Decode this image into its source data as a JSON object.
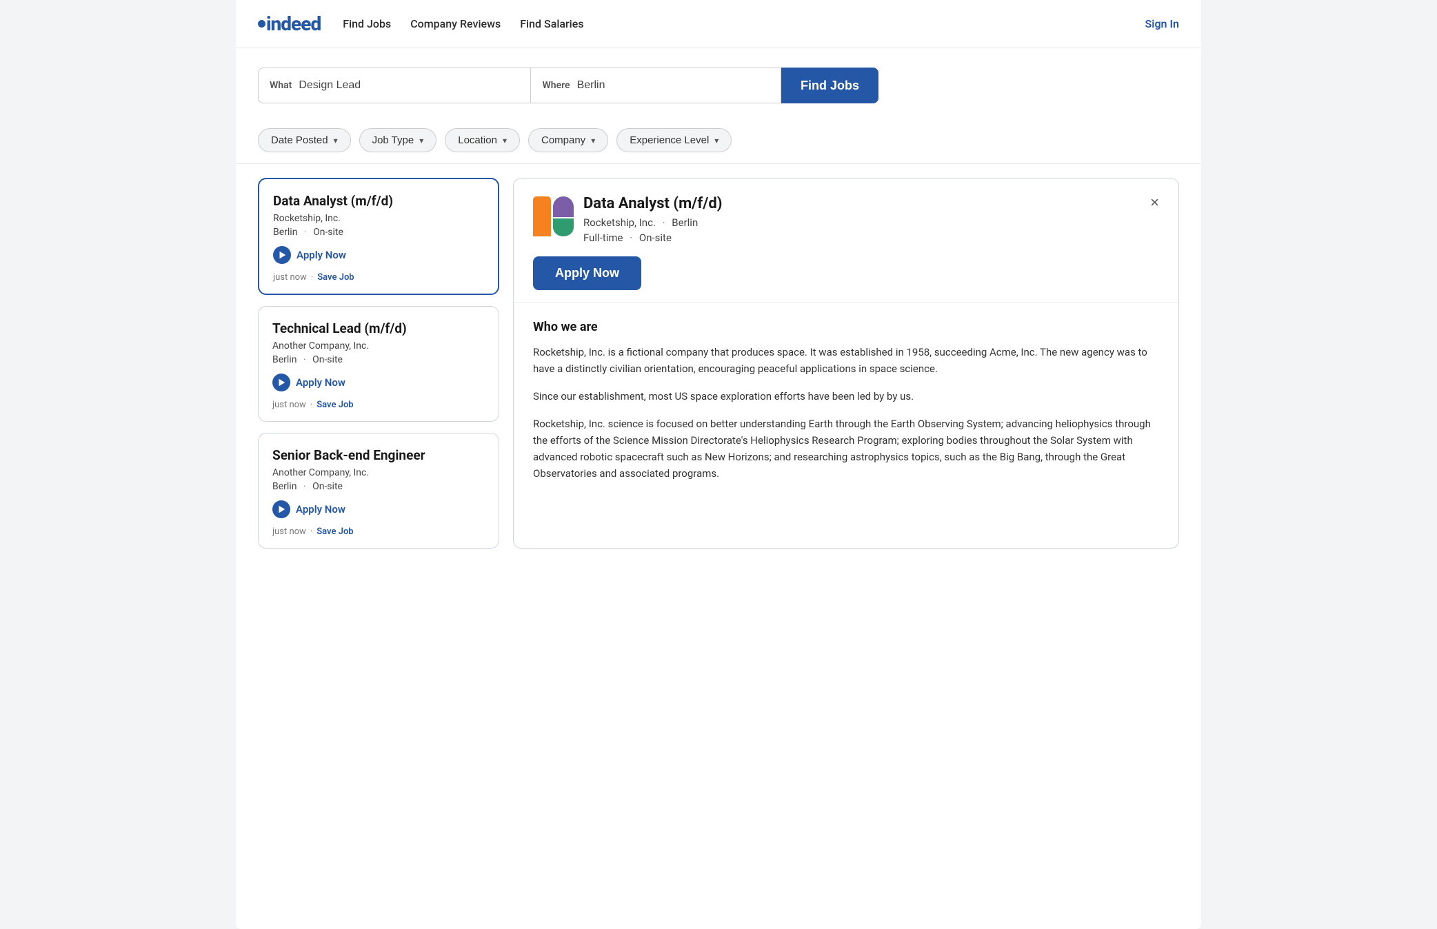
{
  "header": {
    "logo_text": "indeed",
    "nav": [
      {
        "id": "find-jobs",
        "label": "Find Jobs"
      },
      {
        "id": "company-reviews",
        "label": "Company Reviews"
      },
      {
        "id": "find-salaries",
        "label": "Find Salaries"
      }
    ],
    "sign_in": "Sign In"
  },
  "search": {
    "what_label": "What",
    "what_value": "Design Lead",
    "where_label": "Where",
    "where_value": "Berlin",
    "find_jobs_btn": "Find Jobs"
  },
  "filters": [
    {
      "id": "date-posted",
      "label": "Date Posted"
    },
    {
      "id": "job-type",
      "label": "Job Type"
    },
    {
      "id": "location",
      "label": "Location"
    },
    {
      "id": "company",
      "label": "Company"
    },
    {
      "id": "experience-level",
      "label": "Experience Level"
    }
  ],
  "jobs": [
    {
      "id": "job-1",
      "title": "Data Analyst (m/f/d)",
      "company": "Rocketship, Inc.",
      "location": "Berlin",
      "work_type": "On-site",
      "apply_label": "Apply Now",
      "posted": "just now",
      "save_label": "Save Job",
      "selected": true
    },
    {
      "id": "job-2",
      "title": "Technical Lead (m/f/d)",
      "company": "Another Company, Inc.",
      "location": "Berlin",
      "work_type": "On-site",
      "apply_label": "Apply Now",
      "posted": "just now",
      "save_label": "Save Job",
      "selected": false
    },
    {
      "id": "job-3",
      "title": "Senior Back-end Engineer",
      "company": "Another Company, Inc.",
      "location": "Berlin",
      "work_type": "On-site",
      "apply_label": "Apply Now",
      "posted": "just now",
      "save_label": "Save Job",
      "selected": false
    }
  ],
  "job_detail": {
    "title": "Data Analyst (m/f/d)",
    "company": "Rocketship, Inc.",
    "location": "Berlin",
    "job_type": "Full-time",
    "work_type": "On-site",
    "apply_btn": "Apply Now",
    "close_btn": "×",
    "who_we_are_title": "Who we are",
    "who_we_are_p1": "Rocketship, Inc. is a fictional company that produces space. It was established in 1958, succeeding Acme, Inc. The new agency was to have a distinctly civilian orientation, encouraging peaceful applications in space science.",
    "who_we_are_p2": "Since our establishment, most US space exploration efforts have been led by by us.",
    "who_we_are_p3": "Rocketship, Inc. science is focused on better understanding Earth through the Earth Observing System; advancing heliophysics through the efforts of the Science Mission Directorate's Heliophysics Research Program; exploring bodies throughout the Solar System with advanced robotic spacecraft such as New Horizons; and researching astrophysics topics, such as the Big Bang, through the Great Observatories and associated programs."
  }
}
